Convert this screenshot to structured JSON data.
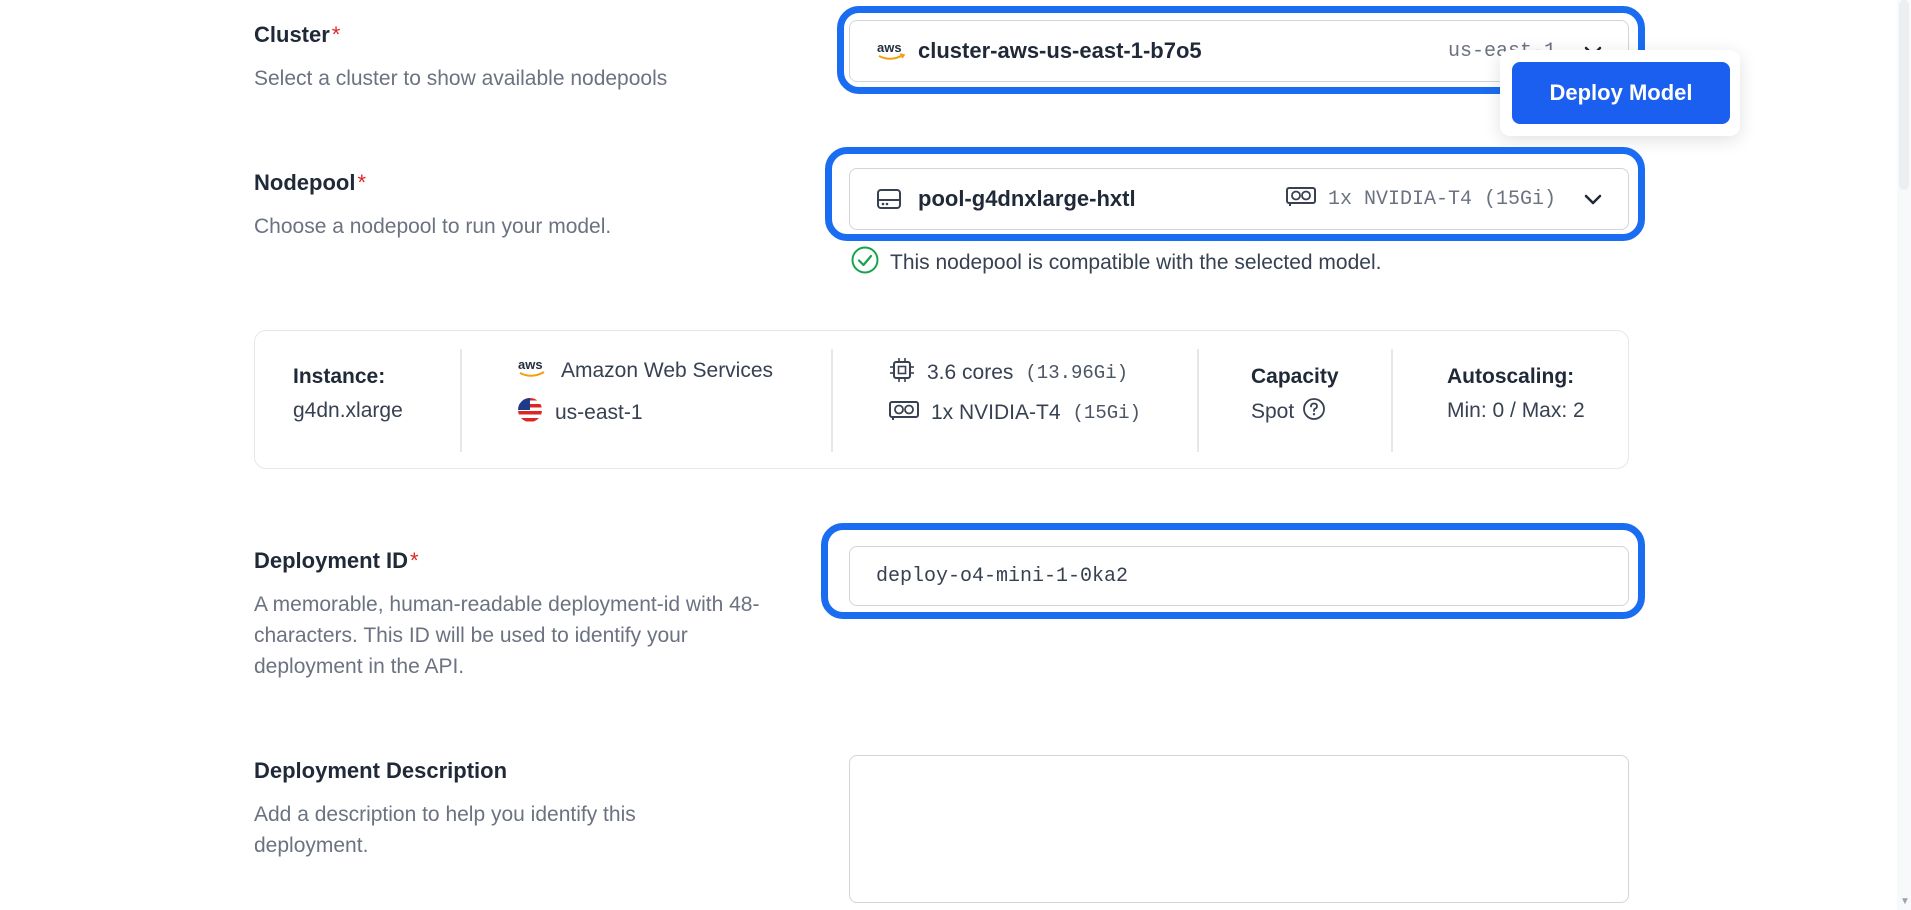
{
  "cluster": {
    "label": "Cluster",
    "required_mark": "*",
    "description": "Select a cluster to show available nodepools",
    "provider_icon": "aws-logo-icon",
    "provider_text": "aws",
    "value": "cluster-aws-us-east-1-b7o5",
    "region": "us-east-1"
  },
  "deploy_button": {
    "label": "Deploy Model"
  },
  "nodepool": {
    "label": "Nodepool",
    "required_mark": "*",
    "description": "Choose a nodepool to run your model.",
    "value": "pool-g4dnxlarge-hxtl",
    "gpu": "1x NVIDIA-T4 (15Gi)",
    "compat_message": "This nodepool is compatible with the selected model."
  },
  "instance_card": {
    "instance_label": "Instance:",
    "instance_value": "g4dn.xlarge",
    "provider_logo_text": "aws",
    "provider_name": "Amazon Web Services",
    "region": "us-east-1",
    "cpu": "3.6 cores",
    "cpu_mem": "(13.96Gi)",
    "gpu": "1x NVIDIA-T4",
    "gpu_mem": "(15Gi)",
    "capacity_label": "Capacity",
    "capacity_value": "Spot",
    "autoscaling_label": "Autoscaling:",
    "autoscaling_value": "Min: 0 / Max: 2"
  },
  "deployment_id": {
    "label": "Deployment ID",
    "required_mark": "*",
    "description": "A memorable, human-readable deployment-id with 48-characters. This ID will be used to identify your deployment in the API.",
    "value": "deploy-o4-mini-1-0ka2"
  },
  "deployment_description": {
    "label": "Deployment Description",
    "description": "Add a description to help you identify this deployment.",
    "value": ""
  },
  "colors": {
    "accent": "#1a5ff0",
    "highlight": "#1a6cf0",
    "required": "#dc2626",
    "success": "#16a34a"
  }
}
